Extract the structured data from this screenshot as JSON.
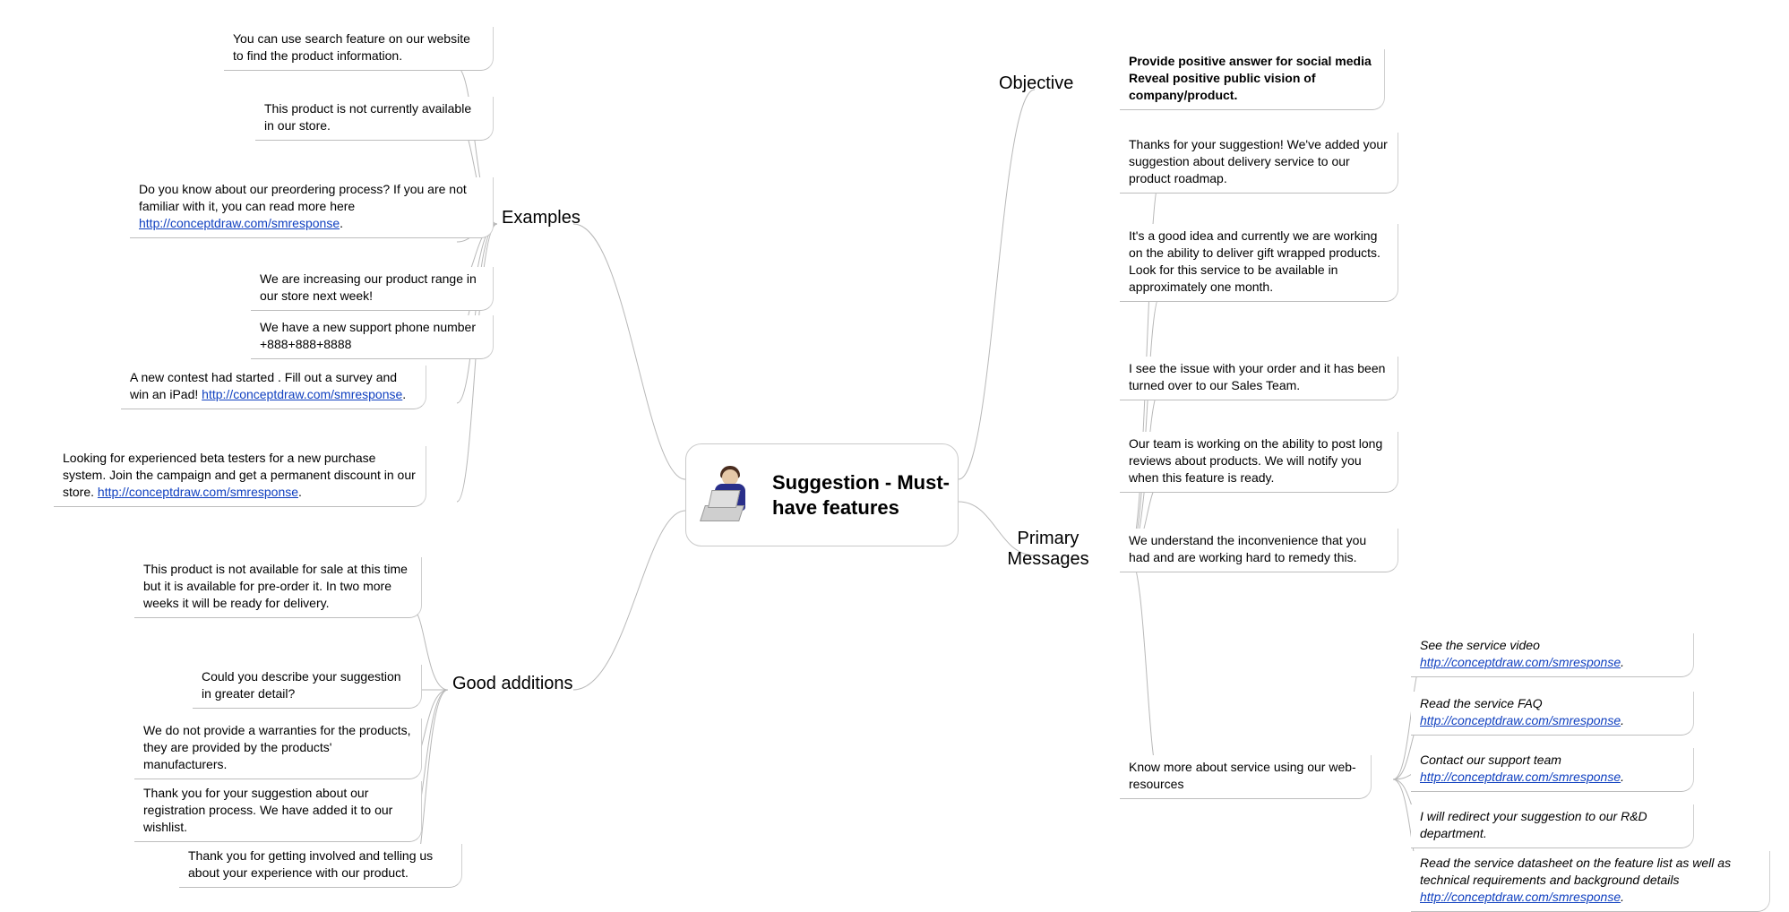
{
  "center_title": "Suggestion - Must-have features",
  "branch_examples": "Examples",
  "branch_good_additions": "Good additions",
  "branch_objective": "Objective",
  "branch_primary_messages": "Primary Messages",
  "link_url": "http://conceptdraw.com/smresponse",
  "ex1": "You can use search feature on our website to find the product information.",
  "ex2": "This product is not currently available in our store.",
  "ex3a": "Do you know about our preordering process? If you are not familiar with it, you can read more here ",
  "ex4": "We are increasing our product range in our store next week!",
  "ex5": "We have a new support phone number +888+888+8888",
  "ex6a": "A new contest had started . Fill out a survey and win an iPad! ",
  "ex7a": "Looking for experienced beta testers for a new purchase system. Join the campaign and get a permanent discount in our store. ",
  "ga1": "This product is not available for sale at this time but it is available for pre-order it. In two more weeks it will be ready for delivery.",
  "ga2": "Could you describe your suggestion in greater detail?",
  "ga3": "We do not provide a warranties for the products, they are provided by the products' manufacturers.",
  "ga4": "Thank you for your suggestion about our registration process. We have added it to our wishlist.",
  "ga5": "Thank you for getting involved and telling us about your experience with our product.",
  "obj1": "Provide positive answer for social media",
  "obj2": "Reveal positive public vision of company/product.",
  "pm1": "Thanks for your suggestion! We've added your suggestion about delivery service to our product roadmap.",
  "pm2": "It's a good idea and currently we are working on the ability to deliver gift wrapped products. Look for this service to be available in approximately one month.",
  "pm3": "I see the issue with your order and it has been turned over to our Sales Team.",
  "pm4": "Our team is working on the ability to post long reviews about products. We will notify you when this feature is ready.",
  "pm5": "We understand the inconvenience that you had and are working hard to remedy this.",
  "pm6": "Know more about service using our web-resources",
  "wr1a": "See the service video ",
  "wr2a": "Read the service FAQ ",
  "wr3a": "Contact our support team ",
  "wr4": "I will redirect your suggestion to our R&D department.",
  "wr5a": "Read the service datasheet on the feature list as well as technical requirements and background details "
}
